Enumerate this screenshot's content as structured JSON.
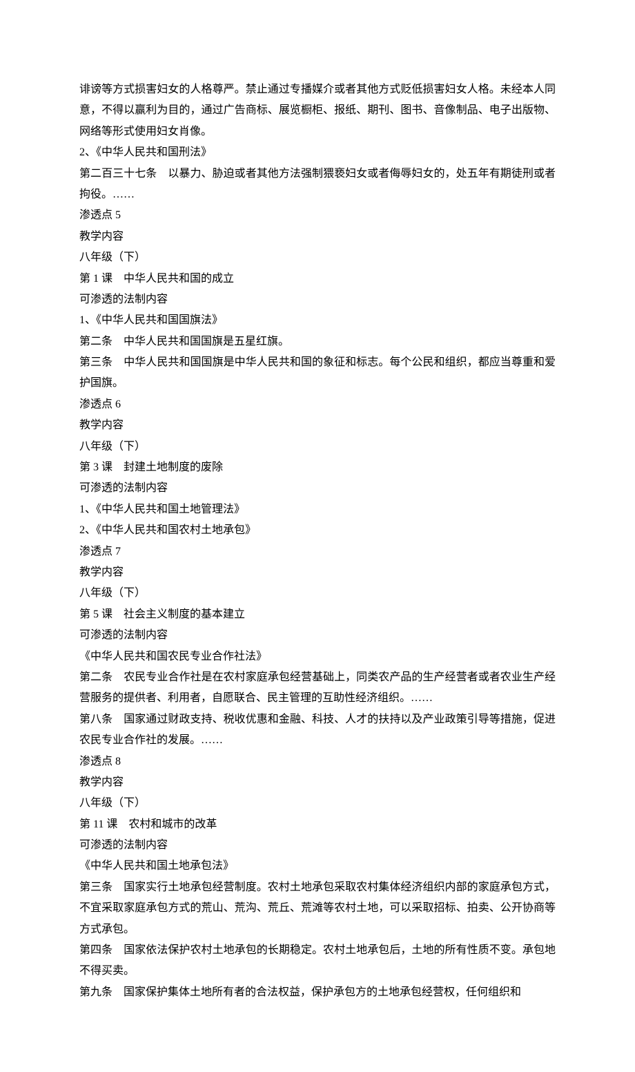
{
  "lines": [
    "诽谤等方式损害妇女的人格尊严。禁止通过专播媒介或者其他方式贬低损害妇女人格。未经本人同意，不得以赢利为目的，通过广告商标、展览橱柜、报纸、期刊、图书、音像制品、电子出版物、网络等形式使用妇女肖像。",
    "2、《中华人民共和国刑法》",
    "第二百三十七条　以暴力、胁迫或者其他方法强制猥亵妇女或者侮辱妇女的，处五年有期徒刑或者拘役。……",
    "渗透点 5",
    "教学内容",
    "八年级（下）",
    "第 1 课　中华人民共和国的成立",
    "可渗透的法制内容",
    "1、《中华人民共和国国旗法》",
    "第二条　中华人民共和国国旗是五星红旗。",
    "第三条　中华人民共和国国旗是中华人民共和国的象征和标志。每个公民和组织，都应当尊重和爱护国旗。",
    "渗透点 6",
    "教学内容",
    "八年级（下）",
    "第 3 课　封建土地制度的废除",
    "可渗透的法制内容",
    "1、《中华人民共和国土地管理法》",
    "2、《中华人民共和国农村土地承包》",
    "渗透点 7",
    "教学内容",
    "八年级（下）",
    "第 5 课　社会主义制度的基本建立",
    "可渗透的法制内容",
    "《中华人民共和国农民专业合作社法》",
    "第二条　农民专业合作社是在农村家庭承包经营基础上，同类农产品的生产经营者或者农业生产经营服务的提供者、利用者，自愿联合、民主管理的互助性经济组织。……",
    "第八条　国家通过财政支持、税收优惠和金融、科技、人才的扶持以及产业政策引导等措施，促进农民专业合作社的发展。……",
    "渗透点 8",
    "教学内容",
    "八年级（下）",
    "第 11 课　农村和城市的改革",
    "可渗透的法制内容",
    "《中华人民共和国土地承包法》",
    "第三条　国家实行土地承包经营制度。农村土地承包采取农村集体经济组织内部的家庭承包方式，不宜采取家庭承包方式的荒山、荒沟、荒丘、荒滩等农村土地，可以采取招标、拍卖、公开协商等方式承包。",
    "第四条　国家依法保护农村土地承包的长期稳定。农村土地承包后，土地的所有性质不变。承包地不得买卖。",
    "第九条　国家保护集体土地所有者的合法权益，保护承包方的土地承包经营权，任何组织和"
  ]
}
